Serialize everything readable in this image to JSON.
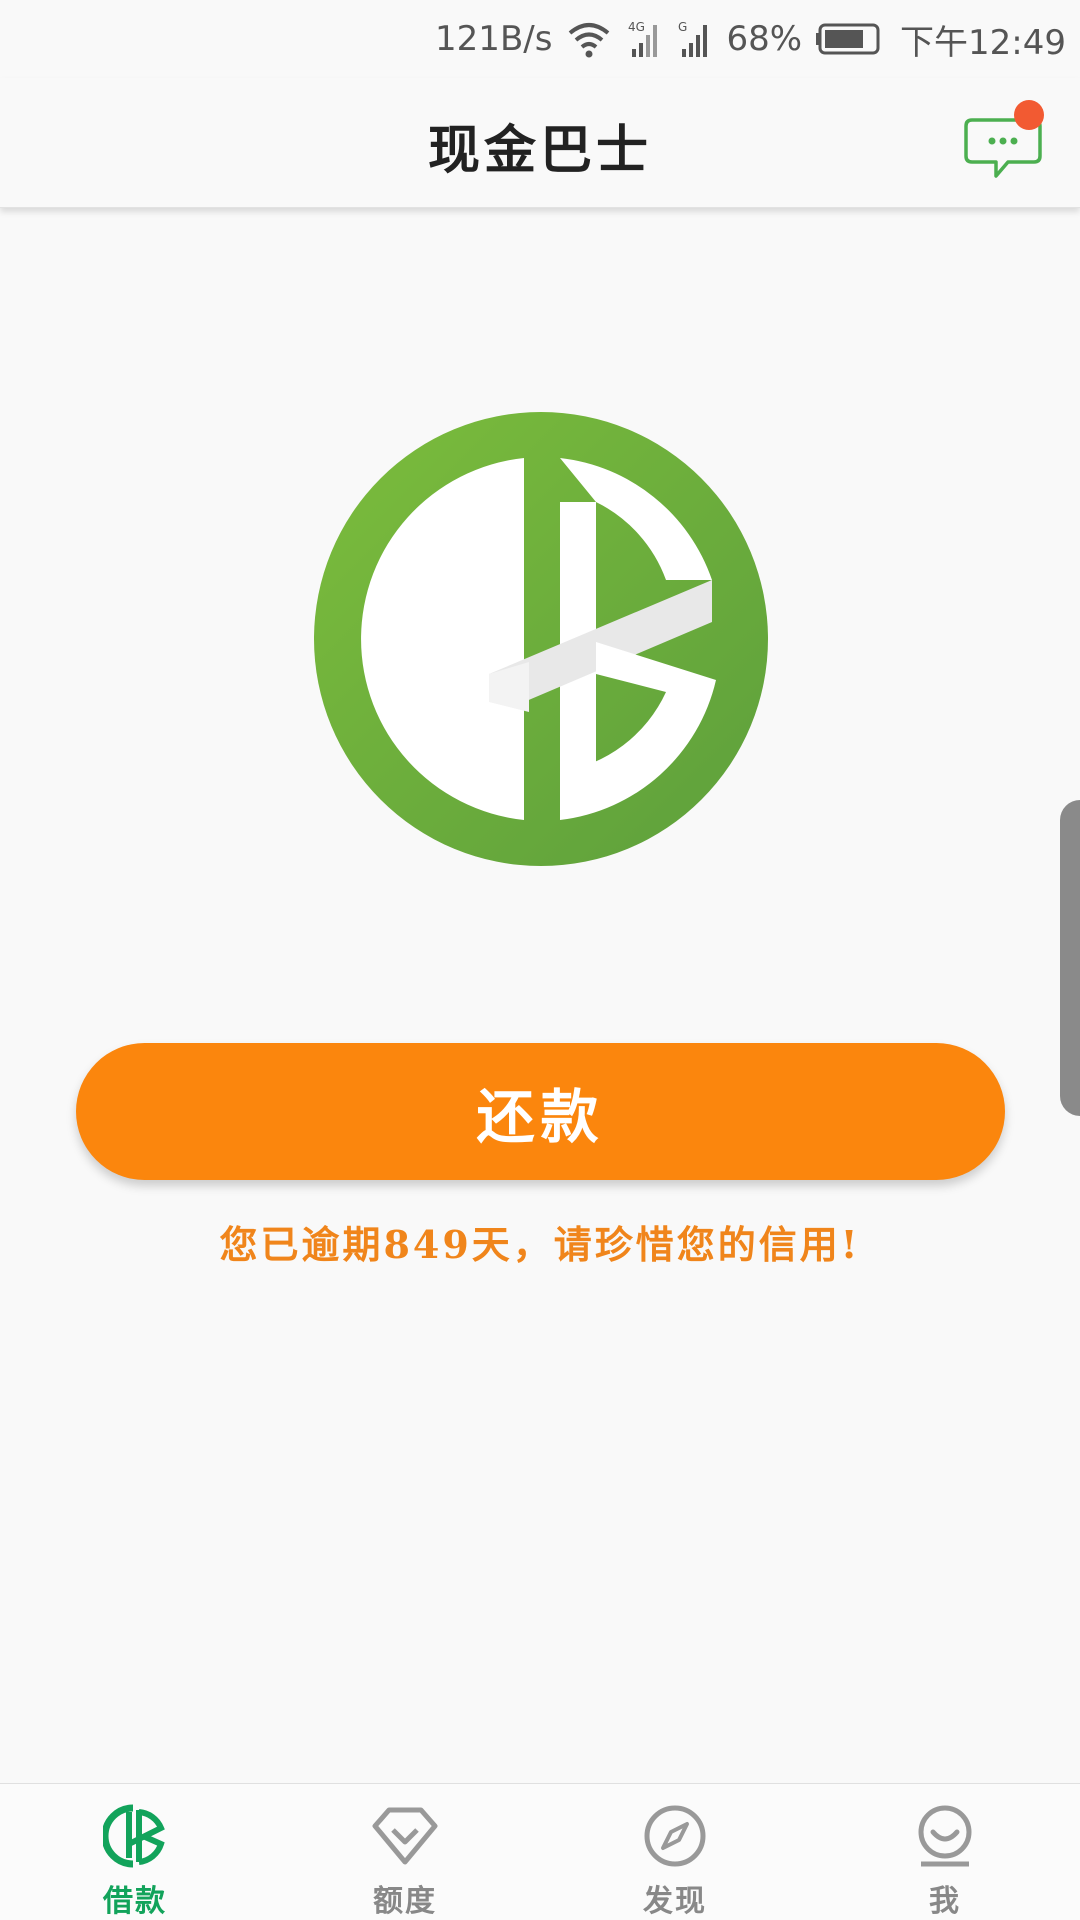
{
  "status_bar": {
    "net_speed": "121B/s",
    "battery": "68%",
    "time": "下午12:49",
    "network_label_1": "4G",
    "network_label_2": "G"
  },
  "header": {
    "title": "现金巴士"
  },
  "main": {
    "repay_label": "还款",
    "overdue_message": "您已逾期849天，请珍惜您的信用!"
  },
  "bottom_nav": {
    "items": [
      {
        "label": "借款",
        "icon": "cb-logo-icon",
        "active": true
      },
      {
        "label": "额度",
        "icon": "diamond-icon",
        "active": false
      },
      {
        "label": "发现",
        "icon": "compass-icon",
        "active": false
      },
      {
        "label": "我",
        "icon": "profile-icon",
        "active": false
      }
    ]
  },
  "colors": {
    "brand_green": "#6aae3a",
    "accent_orange": "#fb860d",
    "active_nav": "#12a35b",
    "notification": "#f25a32"
  }
}
